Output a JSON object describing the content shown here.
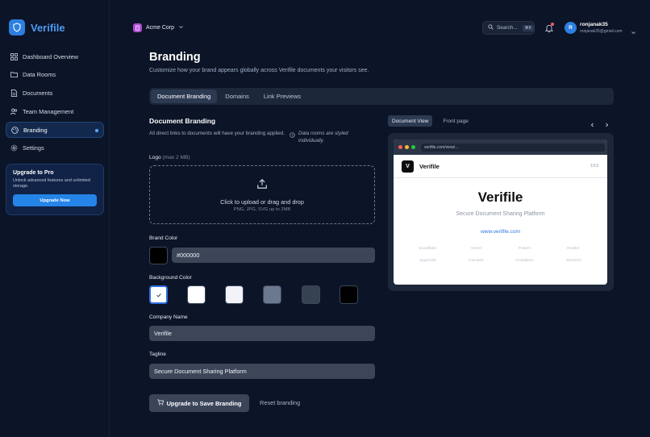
{
  "app": {
    "name": "Verifile"
  },
  "sidebar": {
    "items": [
      {
        "label": "Dashboard Overview",
        "icon": "grid-icon"
      },
      {
        "label": "Data Rooms",
        "icon": "folder-icon"
      },
      {
        "label": "Documents",
        "icon": "document-icon"
      },
      {
        "label": "Team Management",
        "icon": "users-icon"
      },
      {
        "label": "Branding",
        "icon": "palette-icon",
        "active": true
      },
      {
        "label": "Settings",
        "icon": "gear-icon"
      }
    ],
    "upgrade": {
      "title": "Upgrade to Pro",
      "description": "Unlock advanced features and unlimited storage.",
      "button": "Upgrade Now"
    }
  },
  "topbar": {
    "org_name": "Acme Corp",
    "search_placeholder": "Search...",
    "search_shortcut": "⌘K",
    "user": {
      "initial": "R",
      "name": "ronjanak35",
      "email": "ronjanak35@gmail.com"
    }
  },
  "page": {
    "title": "Branding",
    "subtitle": "Customize how your brand appears globally across Verifile documents your visitors see.",
    "tabs": [
      "Document Branding",
      "Domains",
      "Link Previews"
    ]
  },
  "form": {
    "section_title": "Document Branding",
    "section_desc": "All direct links to documents will have your branding applied.",
    "note": "Data rooms are styled individually.",
    "logo_label": "Logo",
    "logo_hint": "(max 2 MB)",
    "upload_main": "Click to upload or drag and drop",
    "upload_sub": "PNG, JPG, SVG up to 2MB",
    "brand_color_label": "Brand Color",
    "brand_color_value": "#000000",
    "background_color_label": "Background Color",
    "background_swatches": [
      "#ffffff",
      "#ffffff",
      "#f1f3f8",
      "#6b7890",
      "#364152",
      "#000000"
    ],
    "company_name_label": "Company Name",
    "company_name_value": "Verifile",
    "tagline_label": "Tagline",
    "tagline_value": "Secure Document Sharing Platform",
    "save_button": "Upgrade to Save Branding",
    "reset_button": "Reset branding"
  },
  "preview": {
    "tabs": [
      "Document View",
      "Front page"
    ],
    "url": "verifile.com/view/...",
    "doc_initial": "V",
    "doc_name": "Verifile",
    "page_indicator": "1/13",
    "title": "Verifile",
    "tagline": "Secure Document Sharing Platform",
    "link": "www.verifile.com",
    "logos": [
      "Snowflake",
      "Vercel",
      "Pattern",
      "Realtor",
      "AppSmith",
      "Coinweb",
      "CrowdDev",
      "Stanford"
    ]
  },
  "colors": {
    "accent": "#2d7fe0",
    "background": "#0c1427",
    "panel": "#1c2739"
  }
}
